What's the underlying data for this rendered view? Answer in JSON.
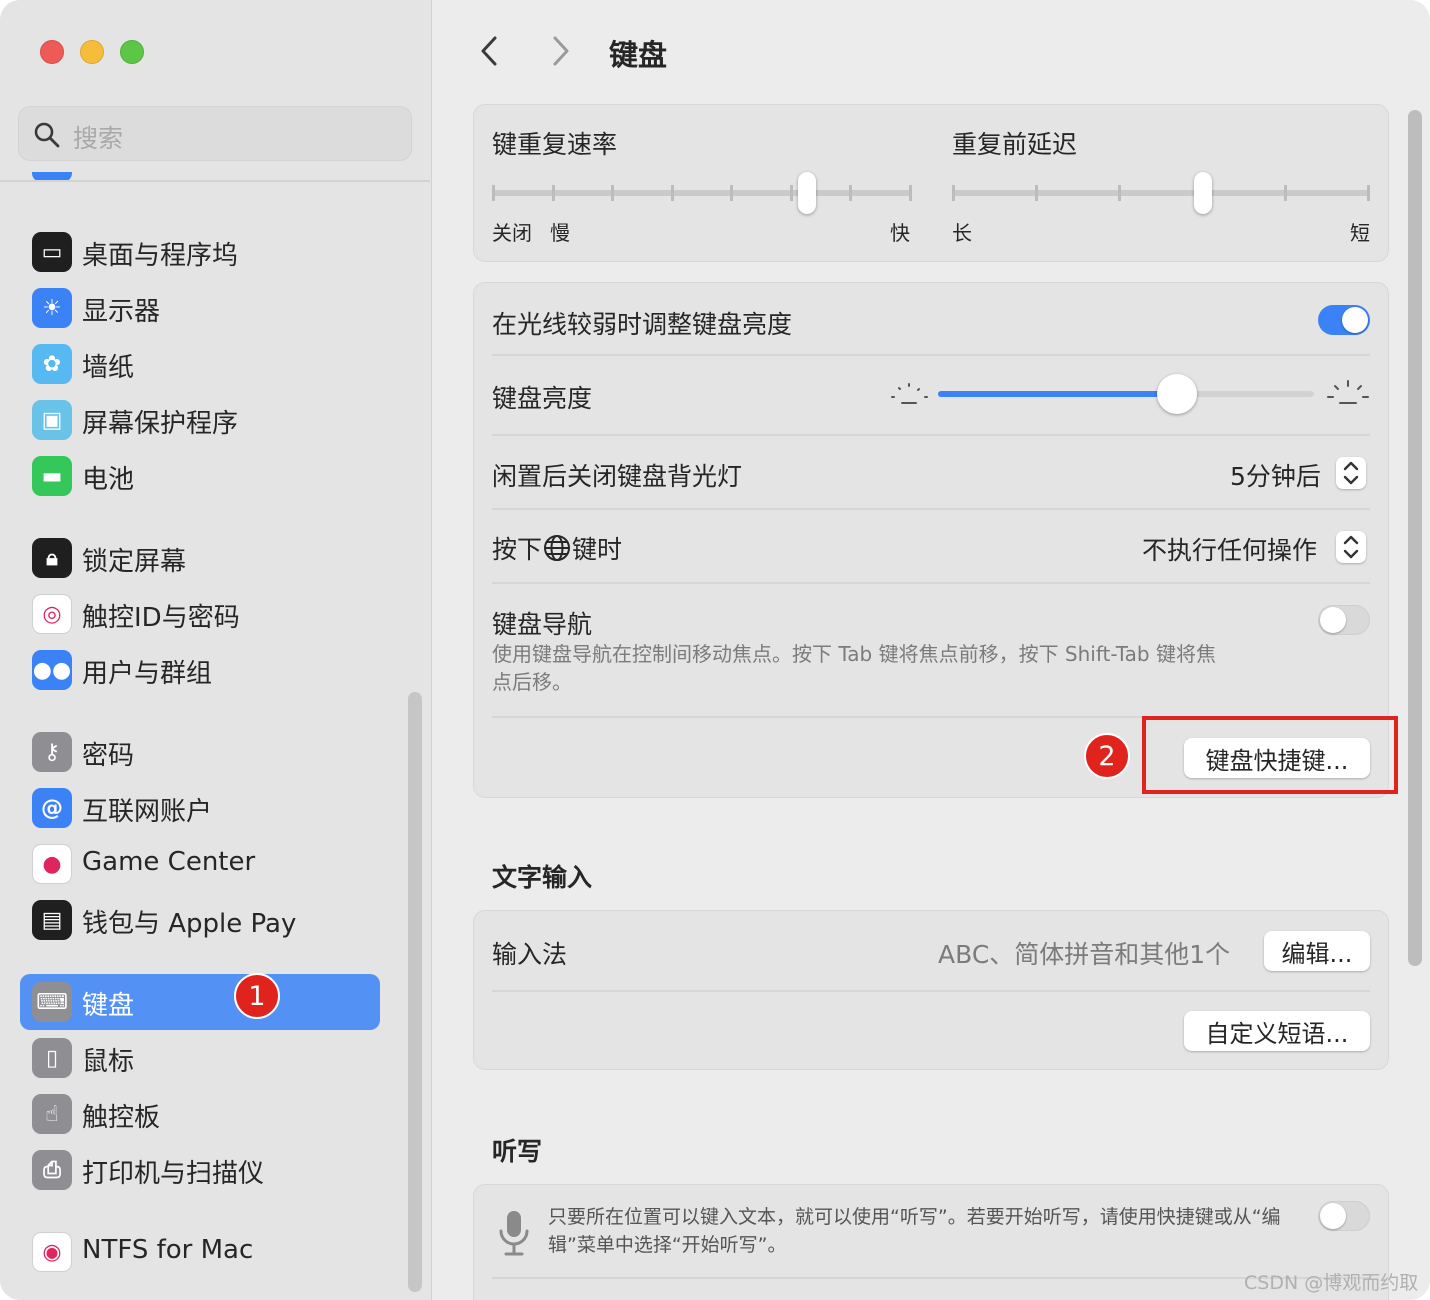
{
  "sidebar": {
    "search_placeholder": "搜索",
    "items": [
      {
        "label": "桌面与程序坞",
        "icon": "dock-icon",
        "color": "#1f1f1f"
      },
      {
        "label": "显示器",
        "icon": "sun-icon",
        "color": "#3b82f6"
      },
      {
        "label": "墙纸",
        "icon": "flower-icon",
        "color": "#56b9f1"
      },
      {
        "label": "屏幕保护程序",
        "icon": "screensaver-icon",
        "color": "#69c3e8"
      },
      {
        "label": "电池",
        "icon": "battery-icon",
        "color": "#34c759"
      },
      {
        "label": "锁定屏幕",
        "icon": "lock-icon",
        "color": "#1f1f1f"
      },
      {
        "label": "触控ID与密码",
        "icon": "fingerprint-icon",
        "color": "#ffffff"
      },
      {
        "label": "用户与群组",
        "icon": "users-icon",
        "color": "#3b82f6"
      },
      {
        "label": "密码",
        "icon": "key-icon",
        "color": "#8e8e93"
      },
      {
        "label": "互联网账户",
        "icon": "at-icon",
        "color": "#3b82f6"
      },
      {
        "label": "Game Center",
        "icon": "game-center-icon",
        "color": "#ffffff"
      },
      {
        "label": "钱包与 Apple Pay",
        "icon": "wallet-icon",
        "color": "#1f1f1f"
      },
      {
        "label": "键盘",
        "icon": "keyboard-icon",
        "color": "#8e8e93",
        "selected": true
      },
      {
        "label": "鼠标",
        "icon": "mouse-icon",
        "color": "#8e8e93"
      },
      {
        "label": "触控板",
        "icon": "trackpad-icon",
        "color": "#8e8e93"
      },
      {
        "label": "打印机与扫描仪",
        "icon": "printer-icon",
        "color": "#8e8e93"
      },
      {
        "label": "NTFS for Mac",
        "icon": "ntfs-icon",
        "color": "#ffffff"
      }
    ],
    "badge": "1"
  },
  "header": {
    "title": "键盘"
  },
  "repeat": {
    "rate_title": "键重复速率",
    "rate_labels": {
      "off": "关闭",
      "slow": "慢",
      "fast": "快"
    },
    "rate_level": 0.75,
    "delay_title": "重复前延迟",
    "delay_labels": {
      "long": "长",
      "short": "短"
    },
    "delay_level": 0.6
  },
  "backlight": {
    "auto_adjust_label": "在光线较弱时调整键盘亮度",
    "auto_adjust_on": true,
    "brightness_label": "键盘亮度",
    "brightness_level": 0.635,
    "idle_label": "闲置后关闭键盘背光灯",
    "idle_value": "5分钟后",
    "globe_label_pre": "按下",
    "globe_label_post": "键时",
    "globe_value": "不执行任何操作",
    "nav_label": "键盘导航",
    "nav_desc": "使用键盘导航在控制间移动焦点。按下 Tab 键将焦点前移，按下 Shift-Tab 键将焦点后移。",
    "nav_on": false,
    "shortcuts_button": "键盘快捷键...",
    "badge": "2"
  },
  "text_input": {
    "section_title": "文字输入",
    "input_method_label": "输入法",
    "input_method_value": "ABC、简体拼音和其他1个",
    "edit_button": "编辑...",
    "custom_phrases_button": "自定义短语..."
  },
  "dictation": {
    "section_title": "听写",
    "desc": "只要所在位置可以键入文本，就可以使用“听写”。若要开始听写，请使用快捷键或从“编辑”菜单中选择“开始听写”。",
    "on": false
  },
  "watermark": "CSDN @博观而约取",
  "colors": {
    "accent": "#3b82f6",
    "selection": "#5491f5",
    "annotation_red": "#e0241d"
  }
}
